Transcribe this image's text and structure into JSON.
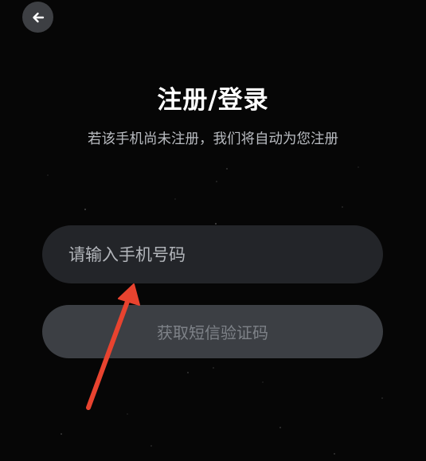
{
  "header": {
    "back_icon": "arrow-left-icon"
  },
  "main": {
    "title": "注册/登录",
    "subtitle": "若该手机尚未注册，我们将自动为您注册",
    "phone_input": {
      "value": "",
      "placeholder": "请输入手机号码"
    },
    "get_code_label": "获取短信验证码"
  },
  "annotation": {
    "icon": "red-arrow-annotation-icon",
    "color": "#e8432f"
  },
  "colors": {
    "background": "#060606",
    "input_bg": "#232529",
    "button_bg": "#3c3f44",
    "button_text": "#7e8288"
  }
}
